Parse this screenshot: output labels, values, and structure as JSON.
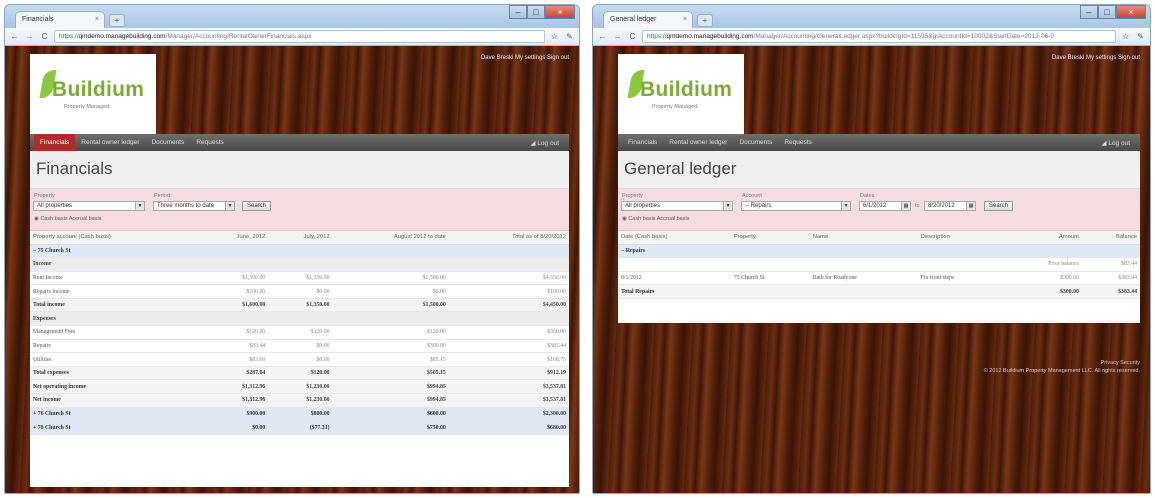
{
  "left": {
    "tab_title": "Financials",
    "url_scheme": "https://",
    "url_host": "qmdemo.managebuilding.com",
    "url_path": "/Manager/Accounting/RentalOwnerFinancials.aspx",
    "logo": {
      "name": "Buildium",
      "tagline": "Property Managed."
    },
    "toplinks": "Dave Breski   My settings   Sign out",
    "nav": [
      "Financials",
      "Rental owner ledger",
      "Documents",
      "Requests"
    ],
    "logout": "Log out",
    "page_title": "Financials",
    "filters": {
      "property_label": "Property",
      "property_value": "All properties",
      "period_label": "Period",
      "period_value": "Three months to date",
      "search": "Search",
      "basis": "Cash basis   Accrual basis"
    },
    "columns": [
      "Property account (Cash basis)",
      "June, 2012",
      "July, 2012",
      "August 2012 to date",
      "Total as of 8/20/2012"
    ],
    "rows": [
      {
        "type": "grp",
        "cells": [
          "− 75 Church St",
          "",
          "",
          "",
          ""
        ]
      },
      {
        "type": "sub",
        "cells": [
          "Income",
          "",
          "",
          "",
          ""
        ]
      },
      {
        "type": "row",
        "cells": [
          "Rent Income",
          "$1,500.00",
          "$1,350.00",
          "$1,500.00",
          "$4,350.00"
        ]
      },
      {
        "type": "row",
        "cells": [
          "Repairs Income",
          "$100.00",
          "$0.00",
          "$0.00",
          "$100.00"
        ]
      },
      {
        "type": "tot",
        "cells": [
          "Total income",
          "$1,600.00",
          "$1,350.00",
          "$1,500.00",
          "$4,450.00"
        ]
      },
      {
        "type": "sub",
        "cells": [
          "Expenses",
          "",
          "",
          "",
          ""
        ]
      },
      {
        "type": "row",
        "cells": [
          "Management Fees",
          "$120.00",
          "$120.00",
          "$120.00",
          "$360.00"
        ]
      },
      {
        "type": "row",
        "cells": [
          "Repairs",
          "$83.44",
          "$0.00",
          "$300.00",
          "$383.44"
        ]
      },
      {
        "type": "row",
        "cells": [
          "Utilities",
          "$83.60",
          "$0.00",
          "$85.15",
          "$168.75"
        ]
      },
      {
        "type": "tot",
        "cells": [
          "Total expenses",
          "$287.04",
          "$120.00",
          "$505.15",
          "$912.19"
        ]
      },
      {
        "type": "tot",
        "cells": [
          "Net operating income",
          "$1,312.96",
          "$1,230.00",
          "$994.85",
          "$3,537.81"
        ]
      },
      {
        "type": "tot",
        "cells": [
          "Net income",
          "$1,312.96",
          "$1,230.00",
          "$994.85",
          "$3,537.81"
        ]
      },
      {
        "type": "grp",
        "cells": [
          "+ 76 Church St",
          "$900.00",
          "$800.00",
          "$600.00",
          "$2,300.00"
        ]
      },
      {
        "type": "grp",
        "cells": [
          "+ 78 Church St",
          "$0.00",
          "($77.31)",
          "$750.00",
          "$680.00"
        ]
      }
    ]
  },
  "right": {
    "tab_title": "General ledger",
    "url_scheme": "https://",
    "url_host": "qmdemo.managebuilding.com",
    "url_path": "/Manager/Accounting/GeneralLedger.aspx?buildingId=11595&gIAccountId=10002&StartDate=2012-06-0",
    "logo": {
      "name": "Buildium",
      "tagline": "Property Managed."
    },
    "toplinks": "Dave Breski   My settings   Sign out",
    "nav": [
      "Financials",
      "Rental owner ledger",
      "Documents",
      "Requests"
    ],
    "logout": "Log out",
    "page_title": "General ledger",
    "filters": {
      "property_label": "Property",
      "property_value": "All properties",
      "account_label": "Account",
      "account_value": "-- Repairs",
      "dates_label": "Dates",
      "start_date": "6/1/2012",
      "to": "to",
      "end_date": "8/20/2012",
      "search": "Search",
      "basis": "Cash basis   Accrual basis"
    },
    "columns": [
      "Date (Cash basis)",
      "Property",
      "Name",
      "Description",
      "Amount",
      "Balance"
    ],
    "rows": [
      {
        "type": "grp",
        "cells": [
          "− Repairs",
          "",
          "",
          "",
          "",
          ""
        ]
      },
      {
        "type": "row",
        "cells": [
          "",
          "",
          "",
          "",
          "Prior balance",
          "$83.44"
        ]
      },
      {
        "type": "row",
        "cells": [
          "8/1/2012",
          "75 Church St",
          "Bath for Roadyone",
          "Fix front steps",
          "$300.00",
          "$383.44"
        ]
      },
      {
        "type": "tot",
        "cells": [
          "Total Repairs",
          "",
          "",
          "",
          "$300.00",
          "$383.44"
        ]
      }
    ],
    "footer": [
      "Privacy   Security",
      "© 2012 Buildium Property Management LLC. All rights reserved."
    ]
  }
}
